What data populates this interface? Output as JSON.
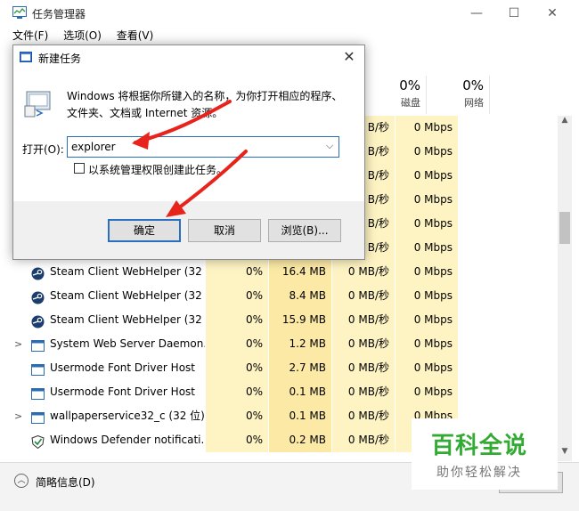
{
  "window": {
    "title": "任务管理器",
    "min": "—",
    "max": "☐",
    "close": "✕"
  },
  "menu": [
    "文件(F)",
    "选项(O)",
    "查看(V)"
  ],
  "columns": [
    {
      "pct": "0%",
      "label": "磁盘"
    },
    {
      "pct": "0%",
      "label": "网络"
    }
  ],
  "rows": [
    {
      "name": "",
      "cpu": "",
      "mem": "",
      "disk": "B/秒",
      "net": "0 Mbps",
      "expander": "",
      "icon": "none"
    },
    {
      "name": "",
      "cpu": "",
      "mem": "",
      "disk": "B/秒",
      "net": "0 Mbps",
      "expander": "",
      "icon": "none"
    },
    {
      "name": "",
      "cpu": "",
      "mem": "",
      "disk": "B/秒",
      "net": "0 Mbps",
      "expander": "",
      "icon": "none"
    },
    {
      "name": "",
      "cpu": "",
      "mem": "",
      "disk": "B/秒",
      "net": "0 Mbps",
      "expander": "",
      "icon": "none"
    },
    {
      "name": "",
      "cpu": "",
      "mem": "",
      "disk": "B/秒",
      "net": "0 Mbps",
      "expander": "",
      "icon": "none"
    },
    {
      "name": "",
      "cpu": "",
      "mem": "",
      "disk": "B/秒",
      "net": "0 Mbps",
      "expander": "",
      "icon": "none"
    },
    {
      "name": "Steam Client WebHelper (32 ...",
      "cpu": "0%",
      "mem": "16.4 MB",
      "disk": "0 MB/秒",
      "net": "0 Mbps",
      "expander": "",
      "icon": "steam"
    },
    {
      "name": "Steam Client WebHelper (32 ...",
      "cpu": "0%",
      "mem": "8.4 MB",
      "disk": "0 MB/秒",
      "net": "0 Mbps",
      "expander": "",
      "icon": "steam"
    },
    {
      "name": "Steam Client WebHelper (32 ...",
      "cpu": "0%",
      "mem": "15.9 MB",
      "disk": "0 MB/秒",
      "net": "0 Mbps",
      "expander": "",
      "icon": "steam"
    },
    {
      "name": "System Web Server Daemon...",
      "cpu": "0%",
      "mem": "1.2 MB",
      "disk": "0 MB/秒",
      "net": "0 Mbps",
      "expander": ">",
      "icon": "window"
    },
    {
      "name": "Usermode Font Driver Host",
      "cpu": "0%",
      "mem": "2.7 MB",
      "disk": "0 MB/秒",
      "net": "0 Mbps",
      "expander": "",
      "icon": "window"
    },
    {
      "name": "Usermode Font Driver Host",
      "cpu": "0%",
      "mem": "0.1 MB",
      "disk": "0 MB/秒",
      "net": "0 Mbps",
      "expander": "",
      "icon": "window"
    },
    {
      "name": "wallpaperservice32_c (32 位)",
      "cpu": "0%",
      "mem": "0.1 MB",
      "disk": "0 MB/秒",
      "net": "0 Mbps",
      "expander": ">",
      "icon": "window"
    },
    {
      "name": "Windows Defender notificati...",
      "cpu": "0%",
      "mem": "0.2 MB",
      "disk": "0 MB/秒",
      "net": "0 Mbps",
      "expander": "",
      "icon": "shield"
    }
  ],
  "footer": {
    "fewer_details": "简略信息(D)"
  },
  "dialog": {
    "title": "新建任务",
    "close": "✕",
    "description": "Windows 将根据你所键入的名称，为你打开相应的程序、文件夹、文档或 Internet 资源。",
    "open_label": "打开(O):",
    "input_value": "explorer",
    "admin_label": "以系统管理权限创建此任务。",
    "ok": "确定",
    "cancel": "取消",
    "browse": "浏览(B)..."
  },
  "watermark": {
    "line1": "百科全说",
    "line2": "助你轻松解决"
  },
  "colors": {
    "accent": "#2a6fbf",
    "arrow": "#e8231b",
    "heat_light": "#fdf3c3",
    "heat_dark": "#fce9a6",
    "watermark": "#33aa33"
  }
}
